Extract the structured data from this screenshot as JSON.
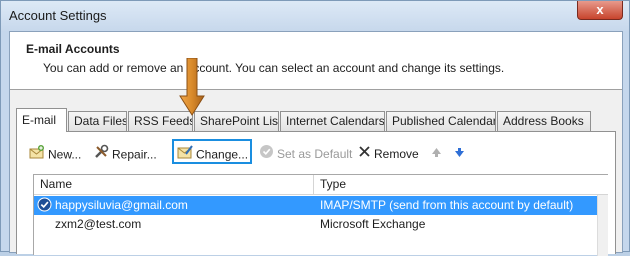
{
  "window": {
    "title": "Account Settings",
    "close_glyph": "x"
  },
  "header": {
    "title": "E-mail Accounts",
    "subtitle": "You can add or remove an account. You can select an account and change its settings."
  },
  "tabs": [
    {
      "label": "E-mail",
      "active": true
    },
    {
      "label": "Data Files"
    },
    {
      "label": "RSS Feeds"
    },
    {
      "label": "SharePoint Lists"
    },
    {
      "label": "Internet Calendars"
    },
    {
      "label": "Published Calendars"
    },
    {
      "label": "Address Books"
    }
  ],
  "toolbar": {
    "new_label": "New...",
    "repair_label": "Repair...",
    "change_label": "Change...",
    "set_default_label": "Set as Default",
    "remove_label": "Remove"
  },
  "list": {
    "columns": [
      "Name",
      "Type"
    ],
    "rows": [
      {
        "name": "happysiluvia@gmail.com",
        "type": "IMAP/SMTP (send from this account by default)",
        "selected": true
      },
      {
        "name": "zxm2@test.com",
        "type": "Microsoft Exchange",
        "selected": false
      }
    ]
  },
  "colors": {
    "selection": "#3399ff",
    "highlight_box": "#1a8ee0",
    "arrow": "#c87a1e"
  },
  "icons": [
    "new-account-icon",
    "repair-icon",
    "change-icon",
    "set-default-icon",
    "remove-x-icon",
    "move-up-icon",
    "move-down-icon",
    "default-check-icon",
    "arrow-pointer-icon"
  ]
}
